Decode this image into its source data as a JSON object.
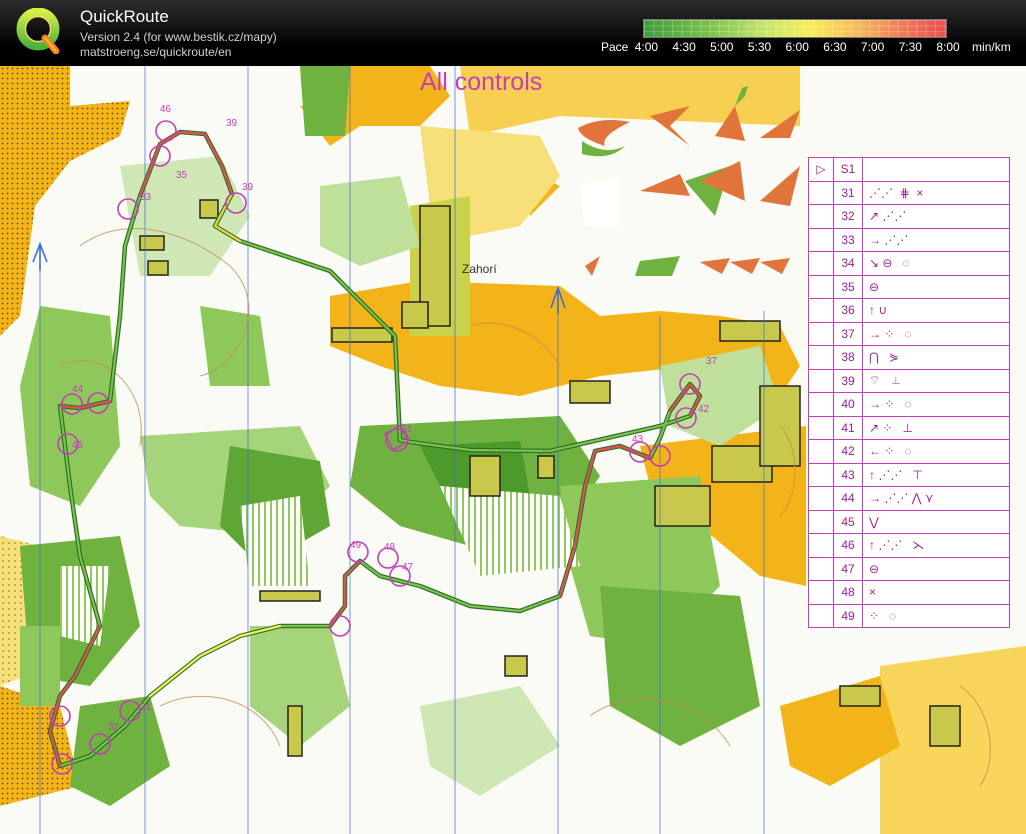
{
  "app": {
    "title": "QuickRoute",
    "version_line": "Version 2.4  (for www.bestik.cz/mapy)",
    "url_line": "matstroeng.se/quickroute/en"
  },
  "pace_scale": {
    "label": "Pace",
    "ticks": [
      "4:00",
      "4:30",
      "5:00",
      "5:30",
      "6:00",
      "6:30",
      "7:00",
      "7:30",
      "8:00"
    ],
    "unit": "min/km",
    "colors": [
      "#3e9b3a",
      "#7cc24a",
      "#c7e46a",
      "#f7ee55",
      "#f5b55a",
      "#ef7a55",
      "#e84c50"
    ]
  },
  "map": {
    "heading": "All controls",
    "place_name": "Zahorí",
    "controls": [
      {
        "label": "S1"
      },
      {
        "label": "31"
      },
      {
        "label": "32"
      },
      {
        "label": "33"
      },
      {
        "label": "34"
      },
      {
        "label": "35"
      },
      {
        "label": "36"
      },
      {
        "label": "37"
      },
      {
        "label": "38"
      },
      {
        "label": "39"
      },
      {
        "label": "40"
      },
      {
        "label": "41"
      },
      {
        "label": "42"
      },
      {
        "label": "43"
      },
      {
        "label": "44"
      },
      {
        "label": "45"
      },
      {
        "label": "46"
      },
      {
        "label": "47"
      },
      {
        "label": "48"
      },
      {
        "label": "49"
      }
    ],
    "colors": {
      "open": "#f2b418",
      "forest": "#6fb23f",
      "white": "#ffffff",
      "purple": "#c33fb6",
      "route_green": "#2f8a2f",
      "route_red": "#d92b2b"
    }
  },
  "control_description": {
    "rows": [
      {
        "code": "S1",
        "symbol": ""
      },
      {
        "code": "31",
        "symbol": "⋰⋰  ⋕  ×"
      },
      {
        "code": "32",
        "symbol": "↗ ⋰⋰"
      },
      {
        "code": "33",
        "symbol": "→ ⋰⋰"
      },
      {
        "code": "34",
        "symbol": "↘ ⊖   ◌"
      },
      {
        "code": "35",
        "symbol": "⊖"
      },
      {
        "code": "36",
        "symbol": "↑ ∪"
      },
      {
        "code": "37",
        "symbol": "→ ⁘   ◌"
      },
      {
        "code": "38",
        "symbol": "⋂   ⋟"
      },
      {
        "code": "39",
        "symbol": "⌔   ⊥"
      },
      {
        "code": "40",
        "symbol": "→ ⁘   ◌"
      },
      {
        "code": "41",
        "symbol": "↗ ⁘   ⊥"
      },
      {
        "code": "42",
        "symbol": "← ⁘   ◌"
      },
      {
        "code": "43",
        "symbol": "↑ ⋰⋰   ⊤"
      },
      {
        "code": "44",
        "symbol": "→ ⋰⋰ ⋀ ⋎"
      },
      {
        "code": "45",
        "symbol": "⋁"
      },
      {
        "code": "46",
        "symbol": "↑ ⋰⋰   ⋋"
      },
      {
        "code": "47",
        "symbol": "⊖"
      },
      {
        "code": "48",
        "symbol": "×"
      },
      {
        "code": "49",
        "symbol": "⁘   ◌"
      }
    ]
  }
}
